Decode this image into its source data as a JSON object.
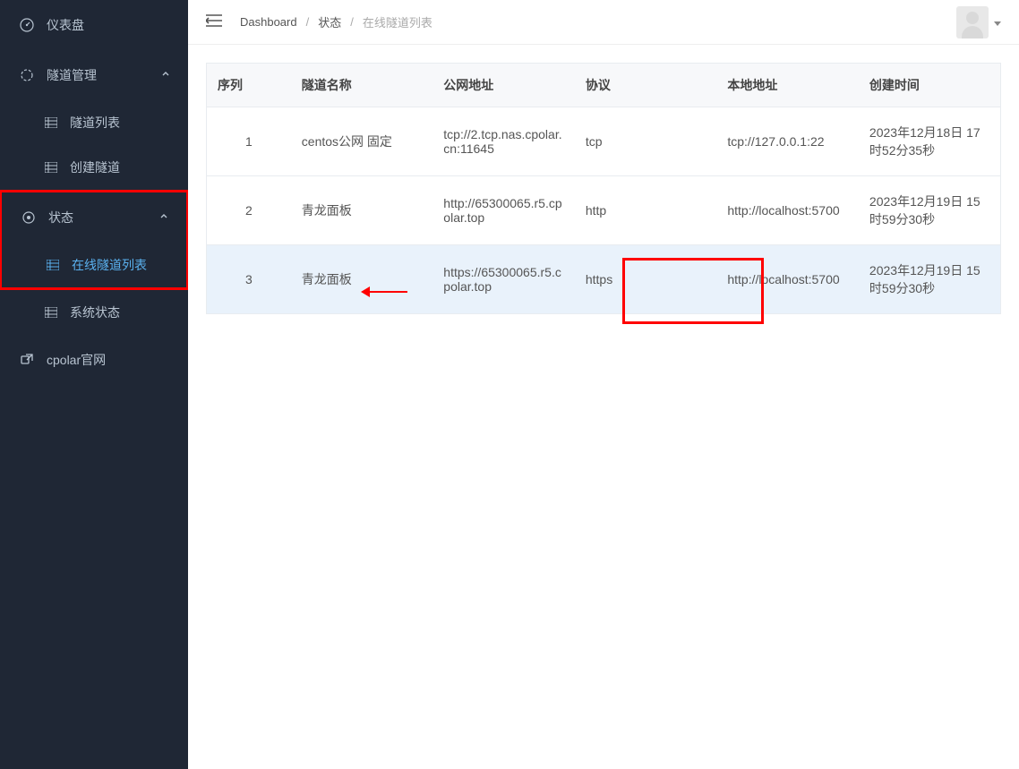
{
  "sidebar": {
    "dashboard": "仪表盘",
    "tunnel_mgmt": "隧道管理",
    "tunnel_list": "隧道列表",
    "create_tunnel": "创建隧道",
    "status": "状态",
    "online_tunnels": "在线隧道列表",
    "system_status": "系统状态",
    "cpolar_site": "cpolar官网"
  },
  "breadcrumb": {
    "dashboard": "Dashboard",
    "status": "状态",
    "current": "在线隧道列表"
  },
  "table": {
    "headers": {
      "seq": "序列",
      "name": "隧道名称",
      "public_url": "公网地址",
      "protocol": "协议",
      "local_url": "本地地址",
      "created": "创建时间"
    },
    "rows": [
      {
        "seq": "1",
        "name": "centos公网 固定",
        "public_url": "tcp://2.tcp.nas.cpolar.cn:11645",
        "protocol": "tcp",
        "local_url": "tcp://127.0.0.1:22",
        "created": "2023年12月18日 17时52分35秒"
      },
      {
        "seq": "2",
        "name": "青龙面板",
        "public_url": "http://65300065.r5.cpolar.top",
        "protocol": "http",
        "local_url": "http://localhost:5700",
        "created": "2023年12月19日 15时59分30秒"
      },
      {
        "seq": "3",
        "name": "青龙面板",
        "public_url": "https://65300065.r5.cpolar.top",
        "protocol": "https",
        "local_url": "http://localhost:5700",
        "created": "2023年12月19日 15时59分30秒"
      }
    ]
  }
}
